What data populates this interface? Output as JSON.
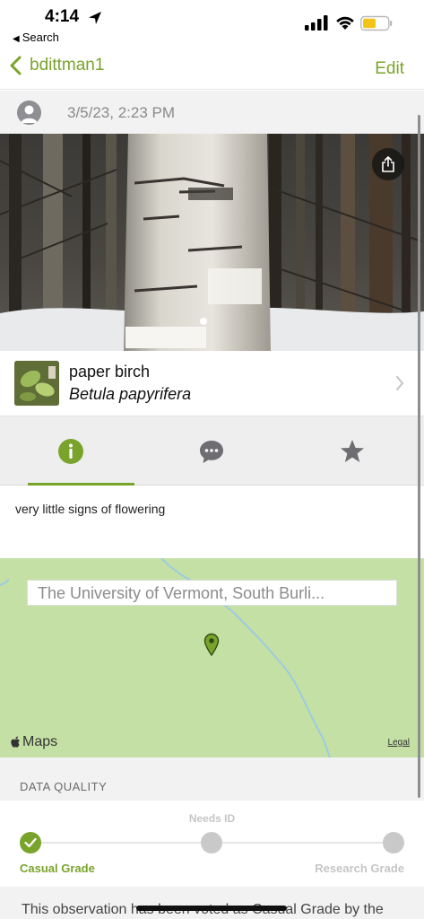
{
  "status_bar": {
    "time": "4:14",
    "back_app": "Search"
  },
  "nav": {
    "back_label": "bdittman1",
    "edit_label": "Edit"
  },
  "observation": {
    "date": "3/5/23, 2:23 PM",
    "photo_count": 1
  },
  "taxon": {
    "common_name": "paper birch",
    "scientific_name": "Betula papyrifera"
  },
  "tabs": [
    {
      "name": "info",
      "icon": "info-icon",
      "selected": true
    },
    {
      "name": "comments",
      "icon": "chat-bubble-icon",
      "selected": false
    },
    {
      "name": "favorites",
      "icon": "star-icon",
      "selected": false
    }
  ],
  "description": "very little signs of flowering",
  "map": {
    "location": "The University of Vermont, South Burli...",
    "brand": "Maps",
    "legal": "Legal"
  },
  "data_quality": {
    "title": "DATA QUALITY",
    "needs_id": "Needs ID",
    "casual": "Casual Grade",
    "research": "Research Grade",
    "current_level": "Casual Grade",
    "explanation": "This observation has been voted as Casual Grade by the"
  },
  "colors": {
    "accent": "#79a42c",
    "map_land": "#c5e0a4"
  }
}
